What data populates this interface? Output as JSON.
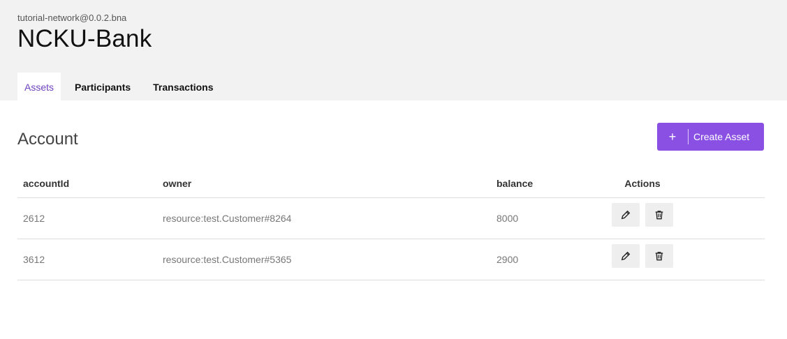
{
  "header": {
    "network": "tutorial-network@0.0.2.bna",
    "title": "NCKU-Bank"
  },
  "tabs": [
    {
      "label": "Assets",
      "active": true
    },
    {
      "label": "Participants",
      "active": false
    },
    {
      "label": "Transactions",
      "active": false
    }
  ],
  "section": {
    "title": "Account",
    "create_button": {
      "icon": "plus-icon",
      "label": "Create Asset"
    }
  },
  "table": {
    "columns": [
      "accountId",
      "owner",
      "balance",
      "Actions"
    ],
    "rows": [
      {
        "accountId": "2612",
        "owner": "resource:test.Customer#8264",
        "balance": "8000"
      },
      {
        "accountId": "3612",
        "owner": "resource:test.Customer#5365",
        "balance": "2900"
      }
    ],
    "row_actions": [
      "edit-icon",
      "delete-icon"
    ]
  },
  "colors": {
    "accent": "#8a4fe3",
    "active_tab_text": "#6f42c1",
    "header_bg": "#f2f2f2"
  }
}
